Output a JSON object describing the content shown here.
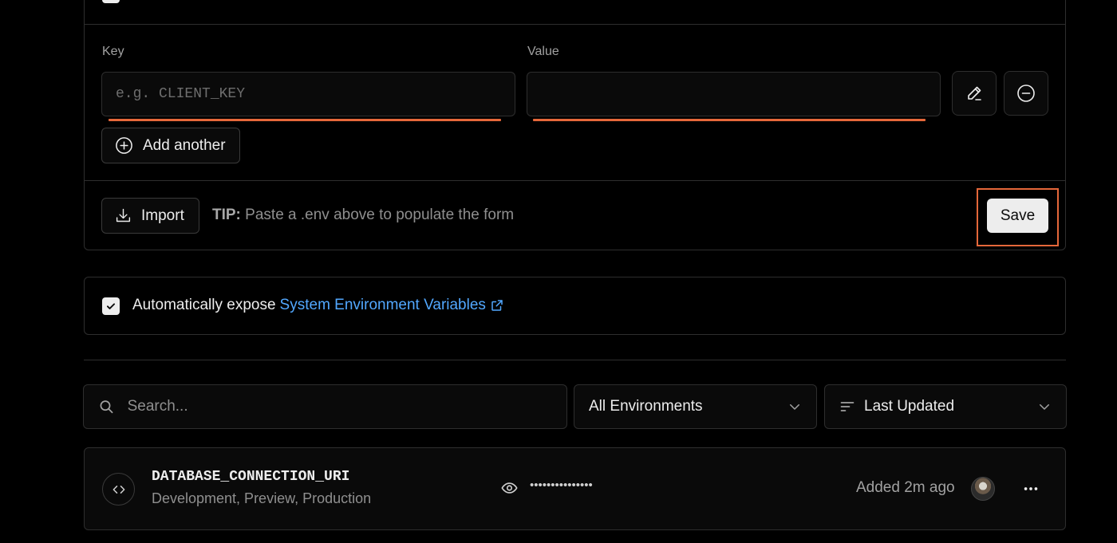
{
  "form": {
    "key_label": "Key",
    "value_label": "Value",
    "key_placeholder": "e.g. CLIENT_KEY",
    "value_value": "",
    "add_another_label": "Add another",
    "import_label": "Import",
    "tip_prefix": "TIP:",
    "tip_text": "Paste a .env above to populate the form",
    "save_label": "Save"
  },
  "system_env": {
    "checked": true,
    "text": "Automatically expose",
    "link_text": "System Environment Variables"
  },
  "filters": {
    "search_placeholder": "Search...",
    "environment_selected": "All Environments",
    "sort_selected": "Last Updated"
  },
  "variables": [
    {
      "name": "DATABASE_CONNECTION_URI",
      "environments": "Development, Preview, Production",
      "masked_value": "•••••••••••••••",
      "added": "Added 2m ago"
    }
  ],
  "colors": {
    "accent_outline": "#e5673a",
    "link": "#52a8ff",
    "background": "#000000"
  },
  "icons": [
    "pencil-icon",
    "minus-circle-icon",
    "plus-circle-icon",
    "download-icon",
    "check-icon",
    "external-link-icon",
    "search-icon",
    "chevron-down-icon",
    "sort-lines-icon",
    "code-icon",
    "eye-icon",
    "more-horizontal-icon"
  ]
}
